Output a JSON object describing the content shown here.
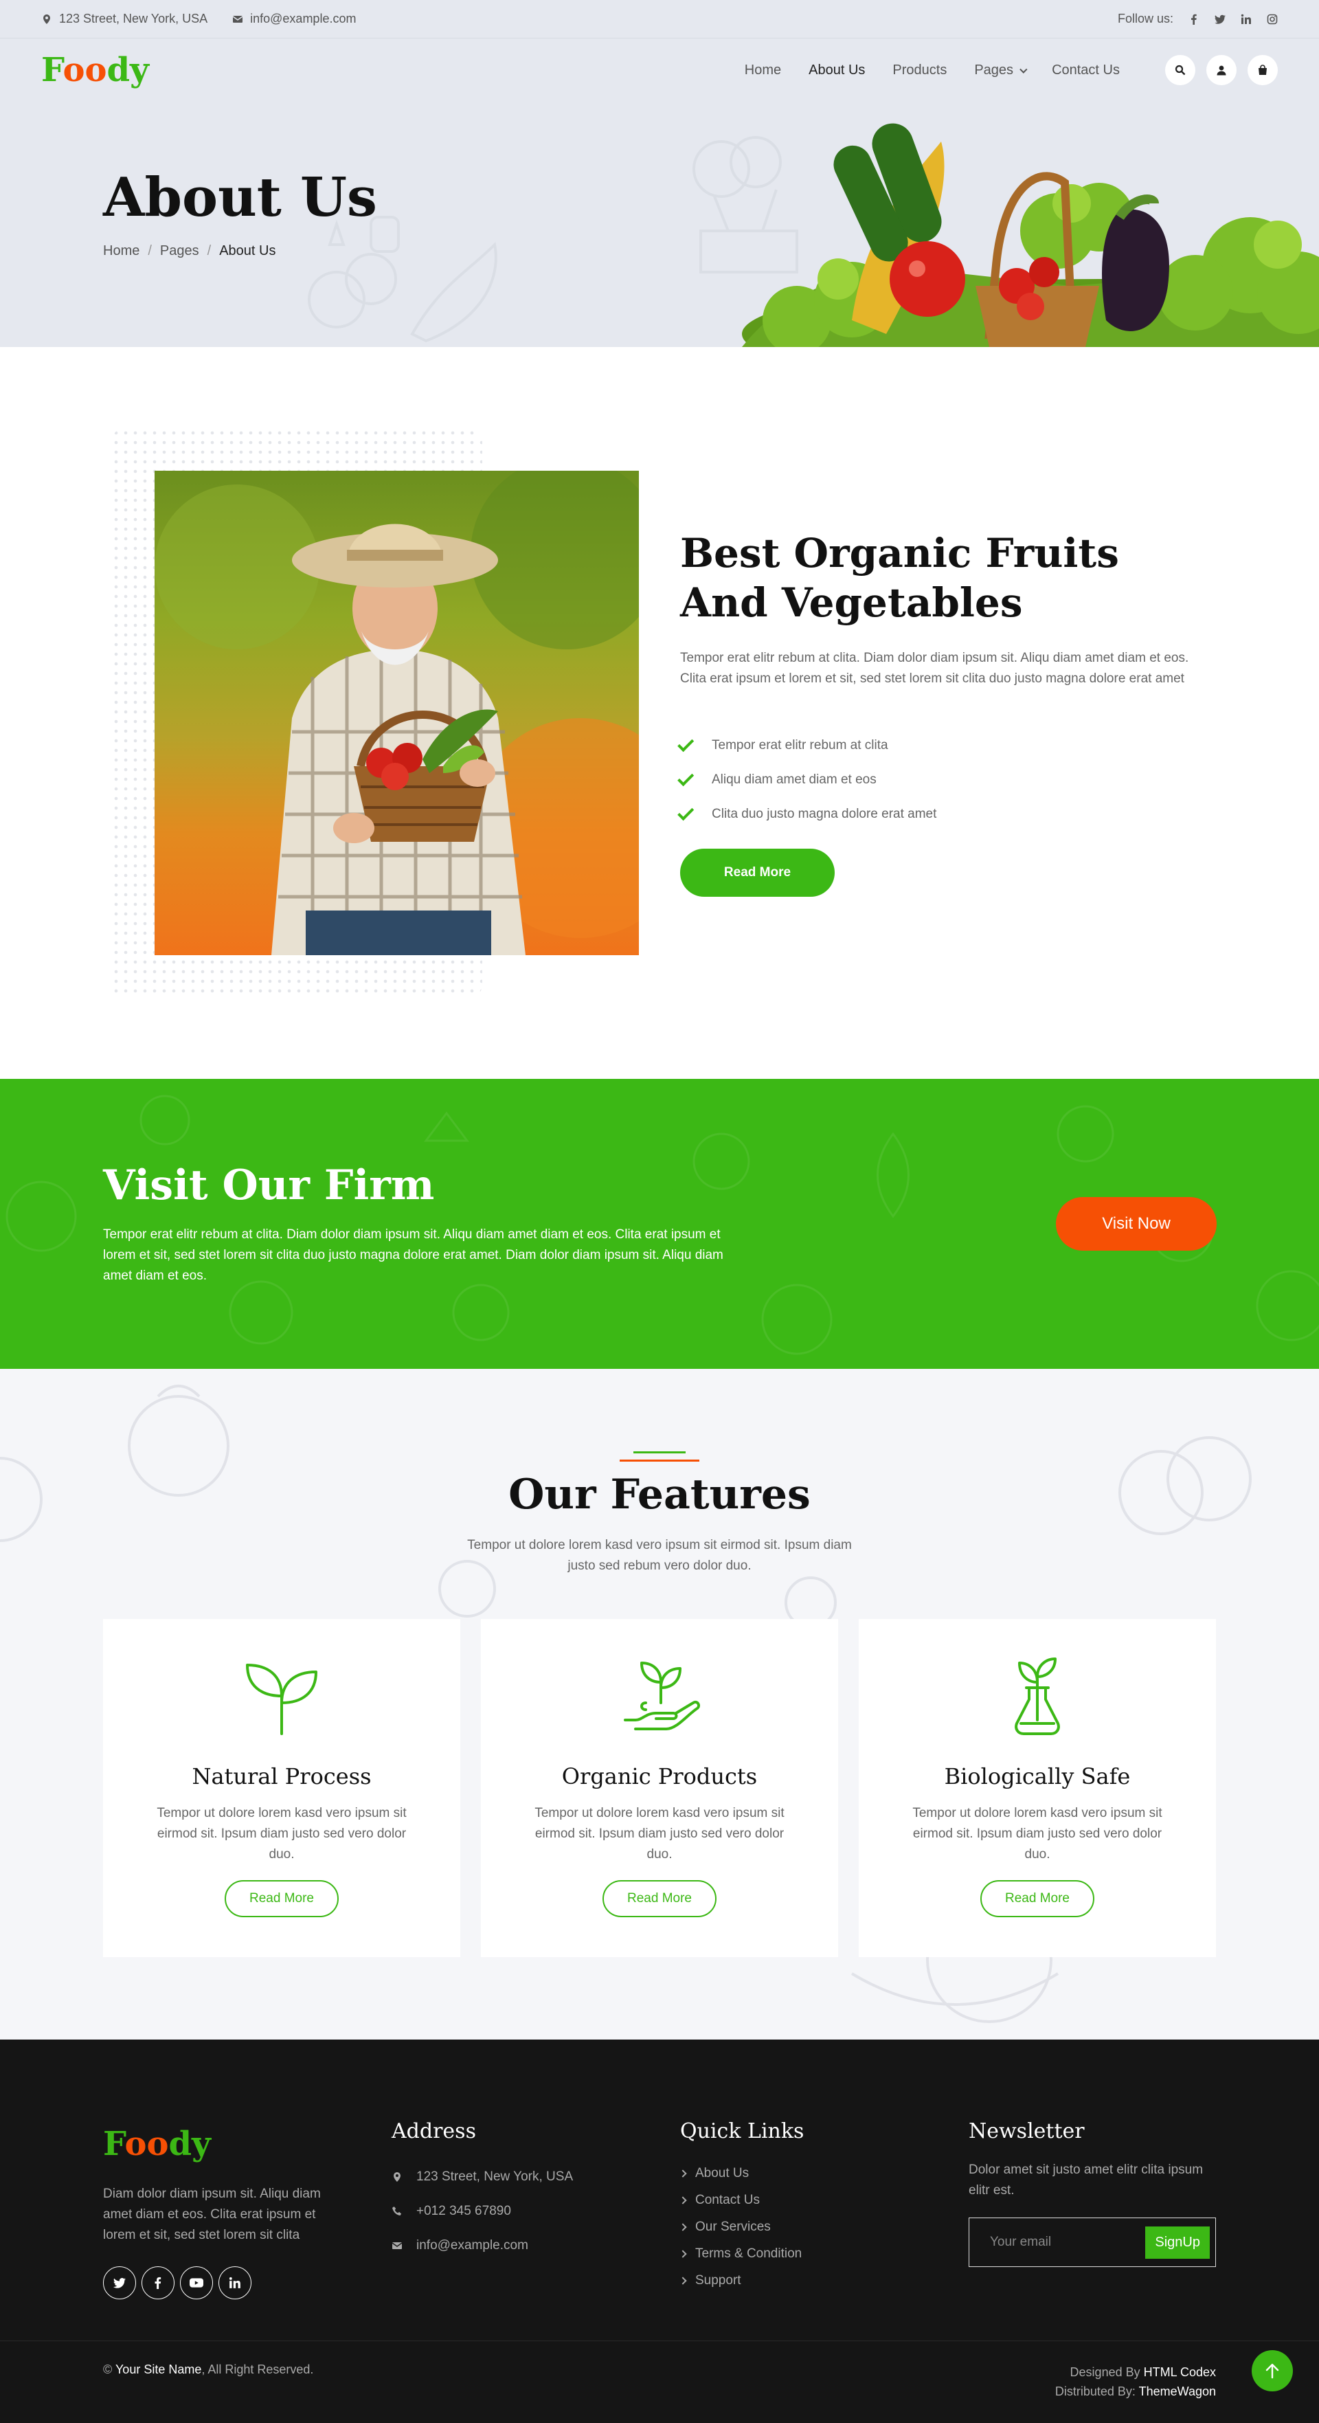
{
  "topbar": {
    "address": "123 Street, New York, USA",
    "email": "info@example.com",
    "follow_label": "Follow us:",
    "socials": [
      "facebook-icon",
      "twitter-icon",
      "linkedin-icon",
      "instagram-icon"
    ]
  },
  "brand": {
    "part1": "F",
    "part2": "oo",
    "part3": "dy"
  },
  "nav": {
    "items": [
      "Home",
      "About Us",
      "Products",
      "Pages",
      "Contact Us"
    ],
    "active": "About Us",
    "icons": [
      "search-icon",
      "user-icon",
      "shopping-bag-icon"
    ]
  },
  "hero": {
    "title": "About Us",
    "breadcrumb": [
      "Home",
      "Pages",
      "About Us"
    ]
  },
  "about": {
    "title": "Best Organic Fruits And Vegetables",
    "text": "Tempor erat elitr rebum at clita. Diam dolor diam ipsum sit. Aliqu diam amet diam et eos. Clita erat ipsum et lorem et sit, sed stet lorem sit clita duo justo magna dolore erat amet",
    "checks": [
      "Tempor erat elitr rebum at clita",
      "Aliqu diam amet diam et eos",
      "Clita duo justo magna dolore erat amet"
    ],
    "button": "Read More"
  },
  "firm": {
    "title": "Visit Our Firm",
    "text": "Tempor erat elitr rebum at clita. Diam dolor diam ipsum sit. Aliqu diam amet diam et eos. Clita erat ipsum et lorem et sit, sed stet lorem sit clita duo justo magna dolore erat amet. Diam dolor diam ipsum sit. Aliqu diam amet diam et eos.",
    "button": "Visit Now"
  },
  "features": {
    "title": "Our Features",
    "subtitle": "Tempor ut dolore lorem kasd vero ipsum sit eirmod sit. Ipsum diam justo sed rebum vero dolor duo.",
    "cards": [
      {
        "icon": "sprout-icon",
        "title": "Natural Process",
        "text": "Tempor ut dolore lorem kasd vero ipsum sit eirmod sit. Ipsum diam justo sed vero dolor duo.",
        "button": "Read More"
      },
      {
        "icon": "hand-plant-icon",
        "title": "Organic Products",
        "text": "Tempor ut dolore lorem kasd vero ipsum sit eirmod sit. Ipsum diam justo sed vero dolor duo.",
        "button": "Read More"
      },
      {
        "icon": "flask-plant-icon",
        "title": "Biologically Safe",
        "text": "Tempor ut dolore lorem kasd vero ipsum sit eirmod sit. Ipsum diam justo sed vero dolor duo.",
        "button": "Read More"
      }
    ]
  },
  "footer": {
    "about_text": "Diam dolor diam ipsum sit. Aliqu diam amet diam et eos. Clita erat ipsum et lorem et sit, sed stet lorem sit clita",
    "address_title": "Address",
    "address": "123 Street, New York, USA",
    "phone": "+012 345 67890",
    "email": "info@example.com",
    "links_title": "Quick Links",
    "links": [
      "About Us",
      "Contact Us",
      "Our Services",
      "Terms & Condition",
      "Support"
    ],
    "newsletter_title": "Newsletter",
    "newsletter_text": "Dolor amet sit justo amet elitr clita ipsum elitr est.",
    "email_placeholder": "Your email",
    "signup": "SignUp",
    "copyright_symbol": "©",
    "site_name": "Your Site Name",
    "rights": ", All Right Reserved.",
    "designed_by_label": "Designed By",
    "designed_by": "HTML Codex",
    "distributed_by_label": "Distributed By:",
    "distributed_by": "ThemeWagon"
  },
  "colors": {
    "primary": "#3cb815",
    "secondary": "#f65005",
    "light": "#e5e8ef",
    "dark": "#151515"
  }
}
